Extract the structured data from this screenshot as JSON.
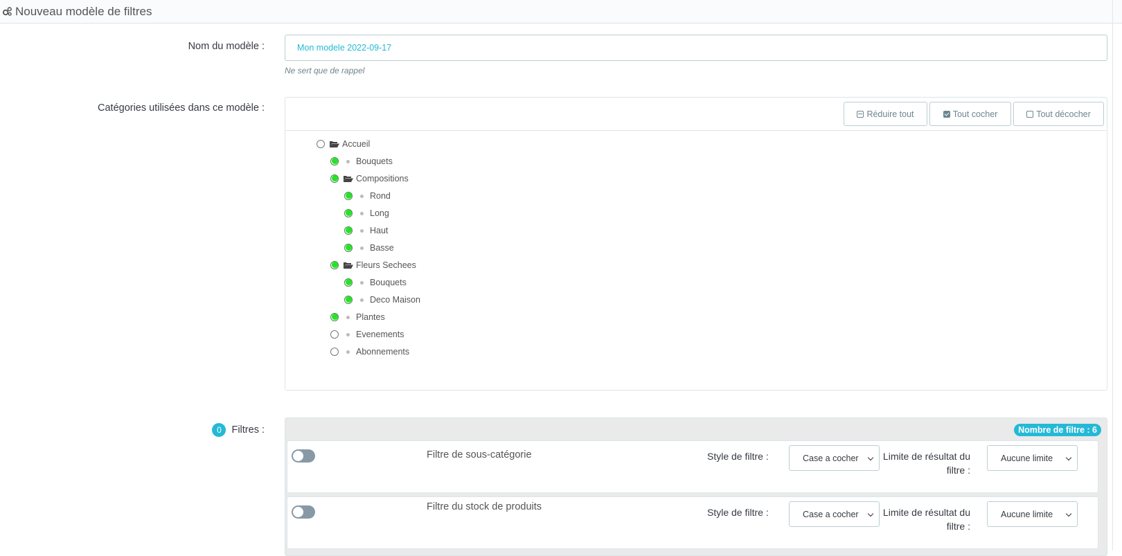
{
  "header": {
    "title": "Nouveau modèle de filtres",
    "icon": "cogs-icon"
  },
  "form": {
    "name_label": "Nom du modèle :",
    "name_value": "Mon modele 2022-09-17",
    "name_help": "Ne sert que de rappel",
    "categories_label": "Catégories utilisées dans ce modèle :",
    "filters_label": "Filtres :",
    "filters_count": "0"
  },
  "tree_toolbar": {
    "collapse_label": "Réduire tout",
    "check_all_label": "Tout cocher",
    "uncheck_all_label": "Tout décocher"
  },
  "tree": [
    {
      "label": "Accueil",
      "checked": false,
      "level": 0,
      "folder": true
    },
    {
      "label": "Bouquets",
      "checked": true,
      "level": 1,
      "folder": false
    },
    {
      "label": "Compositions",
      "checked": true,
      "level": 1,
      "folder": true
    },
    {
      "label": "Rond",
      "checked": true,
      "level": 2,
      "folder": false
    },
    {
      "label": "Long",
      "checked": true,
      "level": 2,
      "folder": false
    },
    {
      "label": "Haut",
      "checked": true,
      "level": 2,
      "folder": false
    },
    {
      "label": "Basse",
      "checked": true,
      "level": 2,
      "folder": false
    },
    {
      "label": "Fleurs Sechees",
      "checked": true,
      "level": 1,
      "folder": true
    },
    {
      "label": "Bouquets",
      "checked": true,
      "level": 2,
      "folder": false
    },
    {
      "label": "Deco Maison",
      "checked": true,
      "level": 2,
      "folder": false
    },
    {
      "label": "Plantes",
      "checked": true,
      "level": 1,
      "folder": false
    },
    {
      "label": "Evenements",
      "checked": false,
      "level": 1,
      "folder": false
    },
    {
      "label": "Abonnements",
      "checked": false,
      "level": 1,
      "folder": false
    }
  ],
  "filters_panel": {
    "count_badge": "Nombre de filtre : 6",
    "rows": [
      {
        "name": "Filtre de sous-catégorie",
        "enabled": false,
        "style_label": "Style de filtre :",
        "style_value": "Case a cocher",
        "limit_label": "Limite de résultat du filtre :",
        "limit_value": "Aucune limite"
      },
      {
        "name": "Filtre du stock de produits",
        "enabled": false,
        "style_label": "Style de filtre :",
        "style_value": "Case a cocher",
        "limit_label": "Limite de résultat du filtre :",
        "limit_value": "Aucune limite"
      }
    ]
  },
  "colors": {
    "accent": "#25b9d7",
    "checked_green": "#28e228",
    "switch_off": "#8899a6"
  }
}
